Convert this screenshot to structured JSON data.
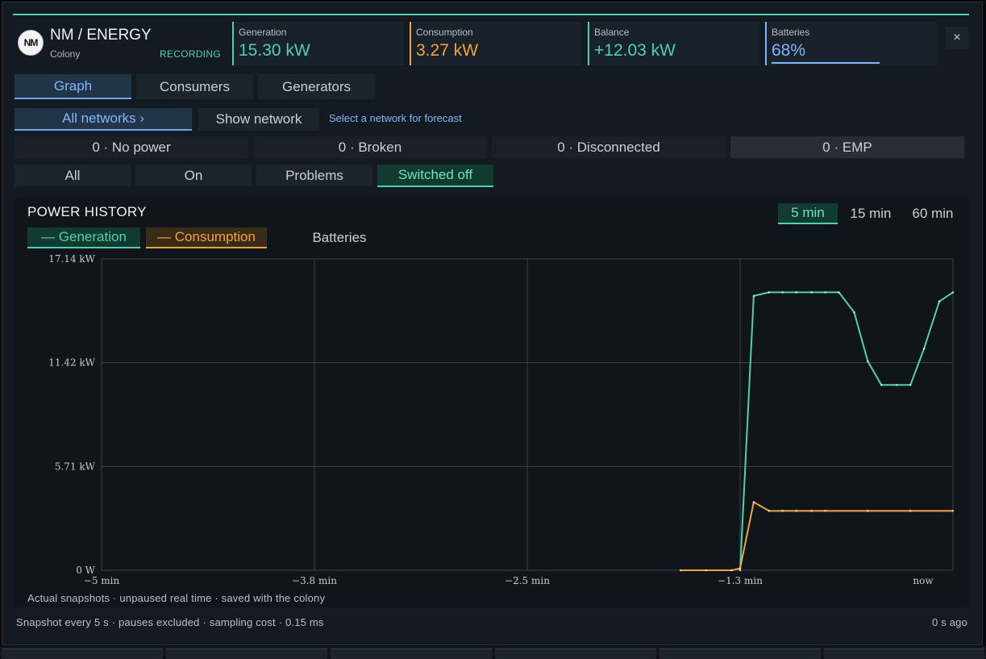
{
  "header": {
    "logo_text": "NM",
    "title": "NM / ENERGY",
    "subtitle": "Colony",
    "recording": "RECORDING",
    "close_label": "×"
  },
  "stats": [
    {
      "label": "Generation",
      "value": "15.30 kW",
      "color": "#4fd1b0"
    },
    {
      "label": "Consumption",
      "value": "3.27 kW",
      "color": "#f0a53c"
    },
    {
      "label": "Balance",
      "value": "+12.03 kW",
      "color": "#4fd1b0"
    },
    {
      "label": "Batteries",
      "value": "68%",
      "color": "#7fb7ff",
      "level": 0.68
    }
  ],
  "tabs": [
    "Graph",
    "Consumers",
    "Generators"
  ],
  "network": {
    "all_label": "All networks  ›",
    "show_label": "Show network",
    "hint": "Select a network for forecast"
  },
  "status_counts": [
    "0 · No power",
    "0 · Broken",
    "0 · Disconnected",
    "0 · EMP"
  ],
  "filters": [
    "All",
    "On",
    "Problems",
    "Switched off"
  ],
  "panel": {
    "title": "POWER HISTORY",
    "ranges": [
      "5 min",
      "15 min",
      "60 min"
    ],
    "legend": [
      "— Generation",
      "— Consumption",
      "Batteries"
    ]
  },
  "chart_data": {
    "type": "line",
    "title": "POWER HISTORY",
    "x_ticks": [
      "−5 min",
      "−3.8 min",
      "−2.5 min",
      "−1.3 min",
      "now"
    ],
    "y_ticks": [
      "0 W",
      "5.71 kW",
      "11.42 kW",
      "17.14 kW"
    ],
    "xlim": [
      -5,
      0
    ],
    "ylim": [
      0,
      17.14
    ],
    "grid": true,
    "series": [
      {
        "name": "Generation",
        "color": "#4fd1b0",
        "x": [
          -1.25,
          -1.17,
          -1.08,
          -1.0,
          -0.92,
          -0.83,
          -0.75,
          -0.67,
          -0.58,
          -0.5,
          -0.42,
          -0.33,
          -0.25,
          -0.17,
          -0.08,
          0
        ],
        "y": [
          0,
          15.1,
          15.3,
          15.3,
          15.3,
          15.3,
          15.3,
          15.3,
          14.2,
          11.5,
          10.2,
          10.2,
          10.2,
          12.2,
          14.8,
          15.3
        ]
      },
      {
        "name": "Consumption",
        "color": "#f0a53c",
        "x": [
          -1.6,
          -1.45,
          -1.3,
          -1.25,
          -1.17,
          -1.08,
          -1.0,
          -0.92,
          -0.83,
          -0.75,
          -0.5,
          -0.25,
          0
        ],
        "y": [
          0,
          0,
          0,
          0.1,
          3.75,
          3.27,
          3.27,
          3.27,
          3.27,
          3.27,
          3.27,
          3.27,
          3.27
        ]
      }
    ]
  },
  "footer": {
    "chart_note": "Actual snapshots · unpaused real time · saved with the colony",
    "sampling": "Snapshot every 5 s · pauses excluded · sampling cost  ·  0.15 ms",
    "age": "0 s ago"
  }
}
